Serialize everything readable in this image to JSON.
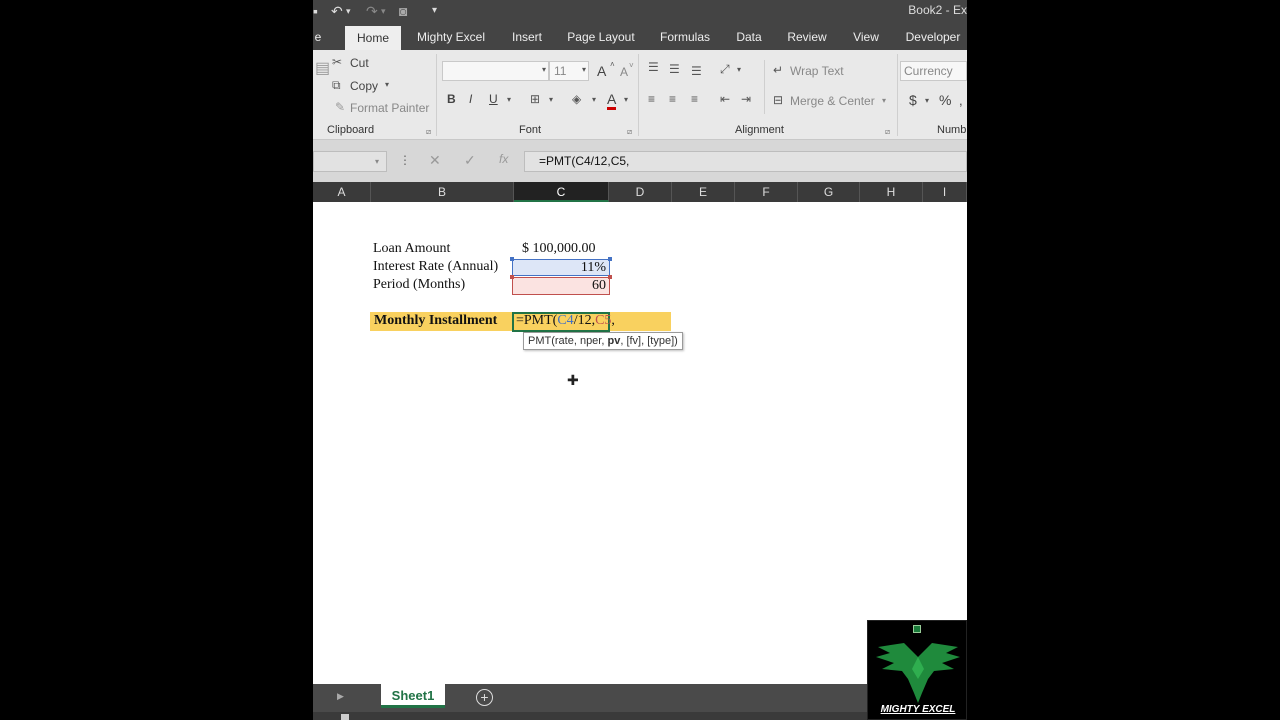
{
  "window": {
    "title": "Book2 - Ex"
  },
  "tabs": [
    {
      "label": "e"
    },
    {
      "label": "Home"
    },
    {
      "label": "Mighty Excel"
    },
    {
      "label": "Insert"
    },
    {
      "label": "Page Layout"
    },
    {
      "label": "Formulas"
    },
    {
      "label": "Data"
    },
    {
      "label": "Review"
    },
    {
      "label": "View"
    },
    {
      "label": "Developer"
    }
  ],
  "ribbon": {
    "clipboard": {
      "cut": "Cut",
      "copy": "Copy",
      "format_painter": "Format Painter",
      "group": "Clipboard"
    },
    "font": {
      "size": "11",
      "group": "Font",
      "bold": "B",
      "italic": "I",
      "underline": "U",
      "grow": "A",
      "font_color": "A"
    },
    "alignment": {
      "wrap_text": "Wrap Text",
      "merge_center": "Merge & Center",
      "group": "Alignment"
    },
    "number": {
      "format": "Currency",
      "dollar": "$",
      "percent": "%",
      "group": "Numb"
    }
  },
  "formula_bar": {
    "value": "=PMT(C4/12,C5,"
  },
  "columns": [
    "A",
    "B",
    "C",
    "D",
    "E",
    "F",
    "G",
    "H",
    "I"
  ],
  "cells": {
    "b4": "Loan Amount",
    "c4": "$ 100,000.00",
    "b5": "Interest Rate (Annual)",
    "c5": "11%",
    "b6": "Period (Months)",
    "c6": "60",
    "b8": "Monthly Installment"
  },
  "edit": {
    "prefix": "=PMT(",
    "ref1": "C4",
    "mid": "/12,",
    "ref2": "C5",
    "suffix": ","
  },
  "tooltip": {
    "pre": "PMT(rate, nper, ",
    "bold": "pv",
    "post": ", [fv], [type])"
  },
  "sheets": [
    {
      "label": "Sheet1"
    }
  ],
  "logo": {
    "text": "MIGHTY EXCEL"
  },
  "colors": {
    "accent": "#217346",
    "highlight": "#f9d15f",
    "ref_blue": "#4472c4",
    "ref_red": "#c0504d"
  }
}
